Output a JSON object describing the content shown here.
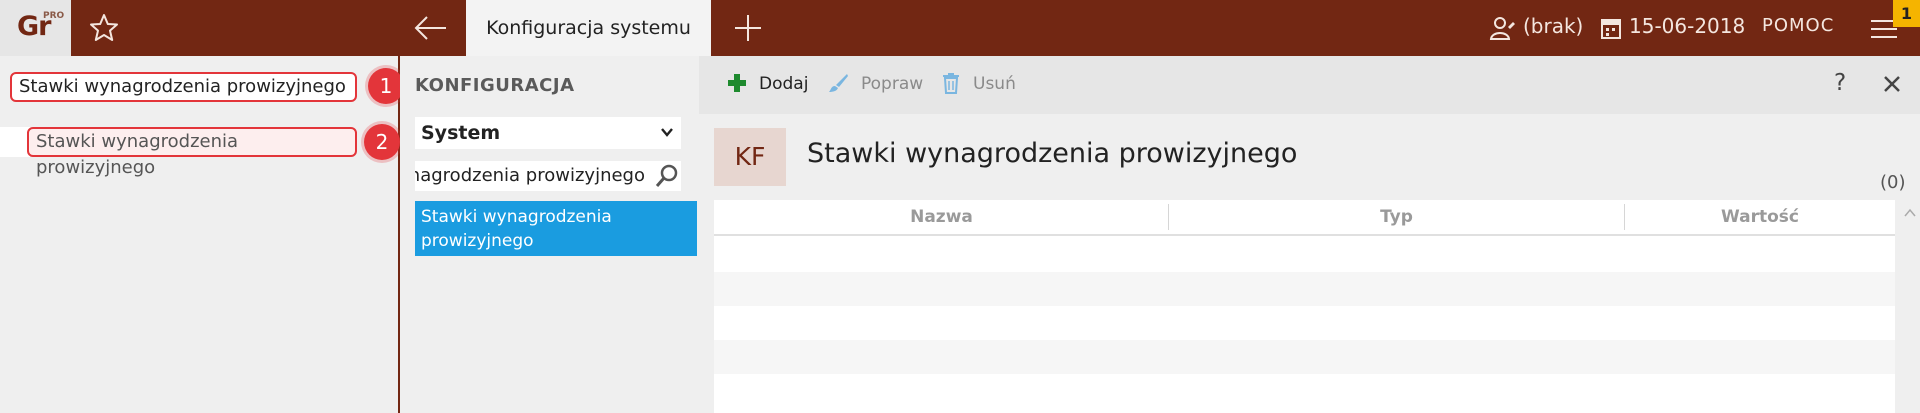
{
  "app": {
    "logo_text": "Gr",
    "logo_sup": "PRO",
    "active_tab": "Konfiguracja systemu",
    "user": "(brak)",
    "date": "15-06-2018",
    "help": "POMOC",
    "notification_count": "1"
  },
  "left": {
    "search_value": "Stawki wynagrodzenia prowizyjnego",
    "result_label": "Stawki wynagrodzenia prowizyjnego",
    "step1": "1",
    "step2": "2"
  },
  "middle": {
    "title": "KONFIGURACJA",
    "select_value": "System",
    "search_value": "ynagrodzenia prowizyjnego",
    "item_label": "Stawki wynagrodzenia prowizyjnego"
  },
  "toolbar": {
    "add_label": "Dodaj",
    "edit_label": "Popraw",
    "delete_label": "Usuń",
    "help_label": "?"
  },
  "content": {
    "badge": "KF",
    "title": "Stawki wynagrodzenia prowizyjnego",
    "count": "(0)",
    "columns": [
      "Nazwa",
      "Typ",
      "Wartość"
    ]
  },
  "colors": {
    "brand": "#722713",
    "highlight": "#1a9ce0",
    "annotation": "#e3353a",
    "add_green": "#1e8a2e",
    "edit_blue": "#7ab6e0"
  }
}
